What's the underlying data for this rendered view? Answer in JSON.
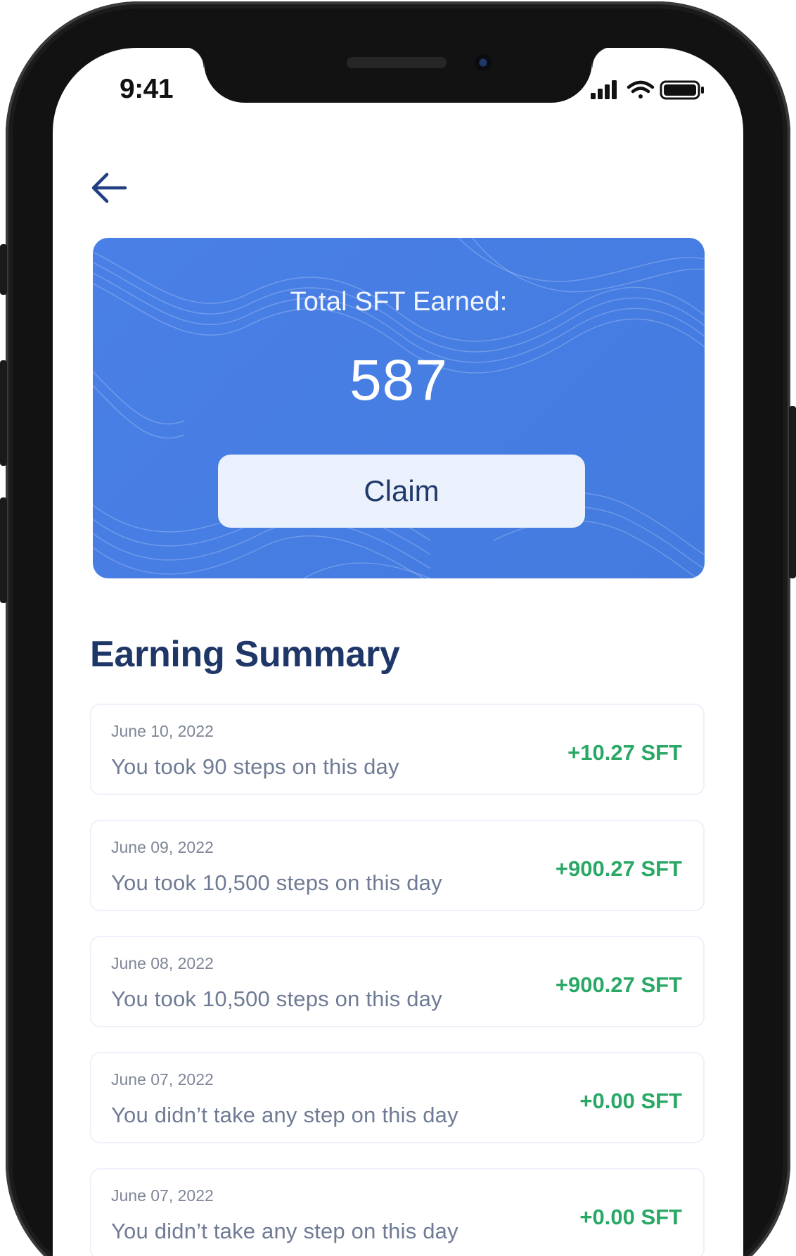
{
  "status_bar": {
    "time": "9:41"
  },
  "header": {
    "back_icon": "arrow-left-icon"
  },
  "card": {
    "title": "Total SFT Earned:",
    "value": "587",
    "button_label": "Claim",
    "background_color": "#4a80e6"
  },
  "summary": {
    "title": "Earning Summary",
    "items": [
      {
        "date": "June 10, 2022",
        "description": "You took 90 steps on this day",
        "amount": "+10.27 SFT"
      },
      {
        "date": "June 09, 2022",
        "description": "You took 10,500 steps on this day",
        "amount": "+900.27 SFT"
      },
      {
        "date": "June 08, 2022",
        "description": "You took 10,500 steps on this day",
        "amount": "+900.27 SFT"
      },
      {
        "date": "June 07, 2022",
        "description": "You didn’t take any step on this day",
        "amount": "+0.00 SFT"
      },
      {
        "date": "June 07, 2022",
        "description": "You didn’t take any step on this day",
        "amount": "+0.00 SFT"
      }
    ],
    "amount_color": "#29a865"
  }
}
